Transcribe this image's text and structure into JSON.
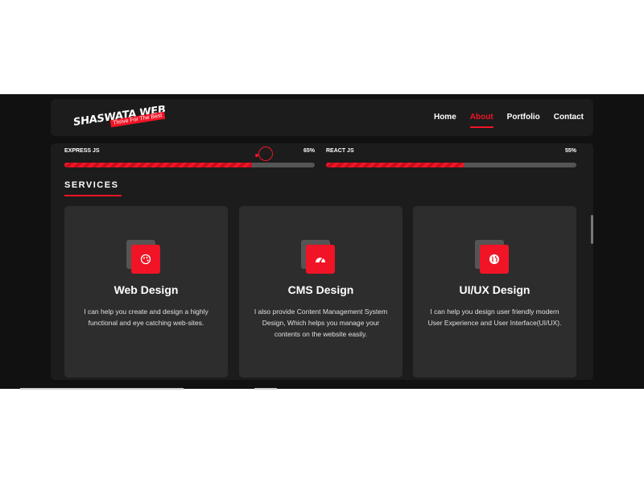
{
  "brand": {
    "name": "SHASWATA WEB",
    "tagline": "Thrive For The Best"
  },
  "nav": {
    "items": [
      "Home",
      "About",
      "Portfolio",
      "Contact"
    ],
    "active": "About"
  },
  "skills": [
    {
      "name": "EXPRESS JS",
      "percent_label": "65%",
      "level": 0.75
    },
    {
      "name": "REACT JS",
      "percent_label": "55%",
      "level": 0.55
    }
  ],
  "services": {
    "title": "SERVICES",
    "cards": [
      {
        "icon": "paint-palette-icon",
        "title": "Web Design",
        "text": "I can help you create and design a highly functional and eye catching web-sites."
      },
      {
        "icon": "dashboard-gauge-icon",
        "title": "CMS Design",
        "text": "I also provide Content Management System Design, Which helps you manage your contents on the website easily."
      },
      {
        "icon": "globe-icon",
        "title": "UI/UX Design",
        "text": "I can help you design user friendly modern User Experience and User Interface(UI/UX)."
      }
    ]
  },
  "colors": {
    "accent": "#f01426",
    "background": "#111111",
    "panel": "#1c1c1c",
    "card": "#2d2d2d"
  }
}
